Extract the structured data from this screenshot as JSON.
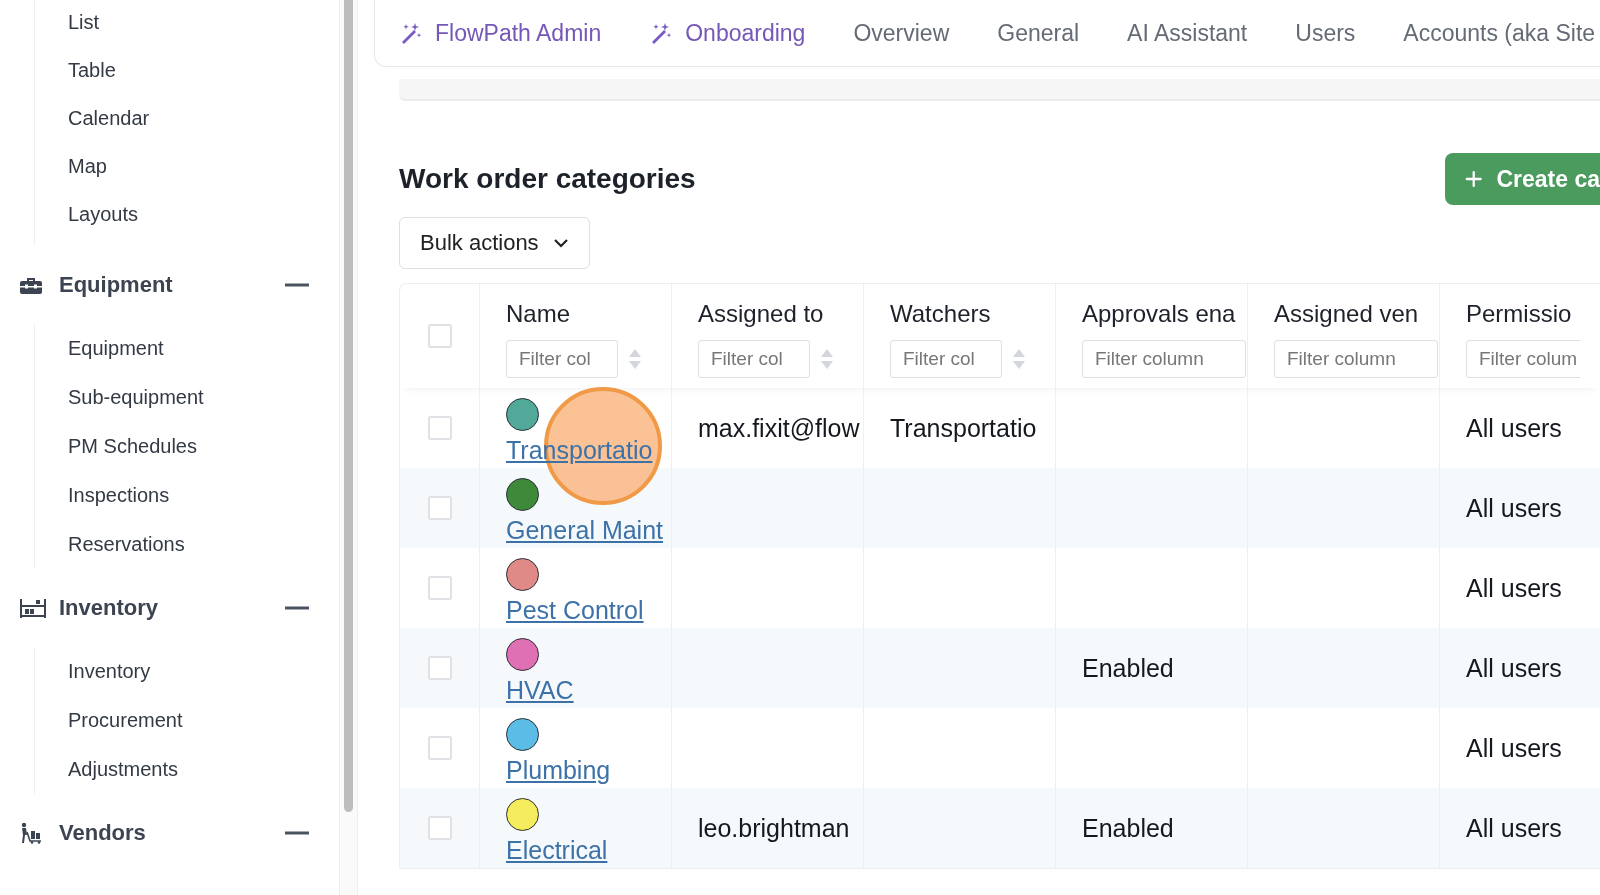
{
  "sidebar": {
    "sections": [
      {
        "items": [
          "List",
          "Table",
          "Calendar",
          "Map",
          "Layouts"
        ]
      },
      {
        "title": "Equipment",
        "expanded": true,
        "items": [
          "Equipment",
          "Sub-equipment",
          "PM Schedules",
          "Inspections",
          "Reservations"
        ]
      },
      {
        "title": "Inventory",
        "expanded": true,
        "items": [
          "Inventory",
          "Procurement",
          "Adjustments"
        ]
      },
      {
        "title": "Vendors",
        "expanded": true
      }
    ]
  },
  "tabs": [
    {
      "label": "FlowPath Admin",
      "kind": "wand"
    },
    {
      "label": "Onboarding",
      "kind": "wand"
    },
    {
      "label": "Overview",
      "kind": "plain"
    },
    {
      "label": "General",
      "kind": "plain"
    },
    {
      "label": "AI Assistant",
      "kind": "plain"
    },
    {
      "label": "Users",
      "kind": "plain"
    },
    {
      "label": "Accounts (aka Site",
      "kind": "plain"
    }
  ],
  "page_title": "Work order categories",
  "create_button": "Create ca",
  "bulk_actions": "Bulk actions",
  "table": {
    "header_checked": false,
    "columns": [
      {
        "label": "Name",
        "placeholder": "Filter col",
        "sortable": true
      },
      {
        "label": "Assigned to",
        "placeholder": "Filter col",
        "sortable": true
      },
      {
        "label": "Watchers",
        "placeholder": "Filter col",
        "sortable": true
      },
      {
        "label": "Approvals ena",
        "placeholder": "Filter column",
        "sortable": false
      },
      {
        "label": "Assigned ven",
        "placeholder": "Filter column",
        "sortable": false
      },
      {
        "label": "Permissio",
        "placeholder": "Filter colum",
        "sortable": false
      }
    ],
    "rows": [
      {
        "checked": false,
        "color": "#52a99a",
        "name": "Transportatio",
        "assigned_to": "max.fixit@flow",
        "watchers": "Transportatio",
        "approvals": "",
        "vendor": "",
        "permissions": "All users"
      },
      {
        "checked": false,
        "color": "#3f8a3a",
        "name": "General Maint",
        "assigned_to": "",
        "watchers": "",
        "approvals": "",
        "vendor": "",
        "permissions": "All users"
      },
      {
        "checked": false,
        "color": "#e08a88",
        "name": "Pest Control",
        "assigned_to": "",
        "watchers": "",
        "approvals": "",
        "vendor": "",
        "permissions": "All users"
      },
      {
        "checked": false,
        "color": "#e070b4",
        "name": "HVAC",
        "assigned_to": "",
        "watchers": "",
        "approvals": "Enabled",
        "vendor": "",
        "permissions": "All users"
      },
      {
        "checked": false,
        "color": "#5bbde6",
        "name": "Plumbing",
        "assigned_to": "",
        "watchers": "",
        "approvals": "",
        "vendor": "",
        "permissions": "All users"
      },
      {
        "checked": false,
        "color": "#f4ec5c",
        "name": "Electrical",
        "assigned_to": "leo.brightman",
        "watchers": "",
        "approvals": "Enabled",
        "vendor": "",
        "permissions": "All users"
      }
    ]
  },
  "click_indicator": true
}
